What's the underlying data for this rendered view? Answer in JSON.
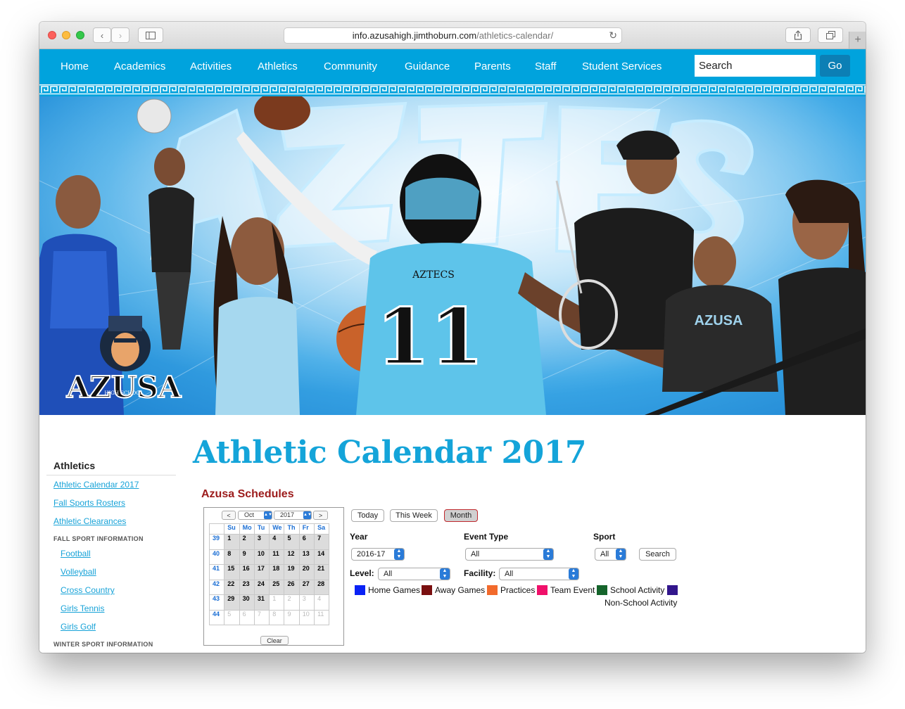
{
  "browser": {
    "url_host": "info.azusahigh.jimthoburn.com",
    "url_path": "/athletics-calendar/"
  },
  "nav": {
    "items": [
      "Home",
      "Academics",
      "Activities",
      "Athletics",
      "Community",
      "Guidance",
      "Parents",
      "Staff",
      "Student Services"
    ],
    "search_value": "Search",
    "go_label": "Go"
  },
  "hero": {
    "logo_text": "AZUSA",
    "logo_subtext": "HIGH SCHOOL",
    "jersey_number": "11",
    "jersey_text": "AZTECS",
    "shirt_text": "AZUSA"
  },
  "sidebar": {
    "title": "Athletics",
    "links": [
      "Athletic Calendar 2017",
      "Fall Sports Rosters",
      "Athletic Clearances"
    ],
    "fall_heading": "FALL SPORT INFORMATION",
    "fall_items": [
      "Football",
      "Volleyball",
      "Cross Country",
      "Girls Tennis",
      "Girls Golf"
    ],
    "winter_heading": "WINTER SPORT INFORMATION"
  },
  "main": {
    "title": "Athletic Calendar 2017",
    "schedules_title": "Azusa Schedules"
  },
  "mini_calendar": {
    "prev": "<",
    "next": ">",
    "month": "Oct",
    "year": "2017",
    "day_headers": [
      "Su",
      "Mo",
      "Tu",
      "We",
      "Th",
      "Fr",
      "Sa"
    ],
    "weeks": [
      {
        "num": "39",
        "days": [
          "1",
          "2",
          "3",
          "4",
          "5",
          "6",
          "7"
        ]
      },
      {
        "num": "40",
        "days": [
          "8",
          "9",
          "10",
          "11",
          "12",
          "13",
          "14"
        ]
      },
      {
        "num": "41",
        "days": [
          "15",
          "16",
          "17",
          "18",
          "19",
          "20",
          "21"
        ]
      },
      {
        "num": "42",
        "days": [
          "22",
          "23",
          "24",
          "25",
          "26",
          "27",
          "28"
        ]
      },
      {
        "num": "43",
        "days": [
          "29",
          "30",
          "31",
          "1",
          "2",
          "3",
          "4"
        ]
      },
      {
        "num": "44",
        "days": [
          "5",
          "6",
          "7",
          "8",
          "9",
          "10",
          "11"
        ]
      }
    ],
    "clear": "Clear"
  },
  "view_buttons": {
    "today": "Today",
    "week": "This Week",
    "month": "Month"
  },
  "filters": {
    "year_label": "Year",
    "year_value": "2016-17",
    "event_type_label": "Event Type",
    "event_type_value": "All",
    "sport_label": "Sport",
    "sport_value": "All",
    "search_label": "Search",
    "level_label": "Level:",
    "level_value": "All",
    "facility_label": "Facility:",
    "facility_value": "All"
  },
  "legend": {
    "items": [
      {
        "label": "Home Games",
        "color": "#0a22f5"
      },
      {
        "label": "Away Games",
        "color": "#7a0f10"
      },
      {
        "label": "Practices",
        "color": "#f26a2c"
      },
      {
        "label": "Team Event",
        "color": "#f0106a"
      },
      {
        "label": "School Activity",
        "color": "#15642b"
      },
      {
        "label": "Non-School Activity",
        "color": "#32168c"
      }
    ]
  },
  "colors": {
    "nav_bg": "#00a3dd",
    "title": "#14a4d9",
    "schedules_title": "#9c1b1b",
    "link": "#18a3d8"
  }
}
